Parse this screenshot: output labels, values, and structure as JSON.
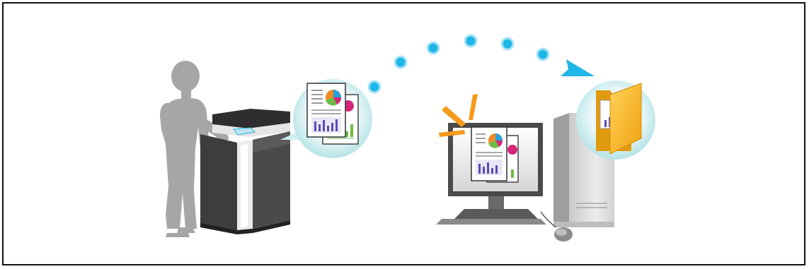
{
  "diagram": {
    "colors": {
      "frame": "#111111",
      "person": "#a6a6a6",
      "mfp_body": "#3d3d3d",
      "mfp_light": "#e6e6e6",
      "accent_blue": "#1fb6e8",
      "bubble_teal": "#bfe6e8",
      "folder_orange": "#f7b21a",
      "burst_orange": "#f59a1a",
      "pie_green": "#6dbb45",
      "pie_orange": "#f08a24",
      "pie_magenta": "#d4267a",
      "pie_blue": "#2a9fd8",
      "bar_purple": "#5b4ab8",
      "monitor_dark": "#4a4a4a",
      "tower_light": "#d9d9d9"
    },
    "icons": [
      "person-icon",
      "multifunction-printer-icon",
      "document-icon",
      "transfer-dots-icon",
      "arrow-icon",
      "monitor-icon",
      "computer-tower-icon",
      "mouse-icon",
      "folder-icon"
    ]
  }
}
